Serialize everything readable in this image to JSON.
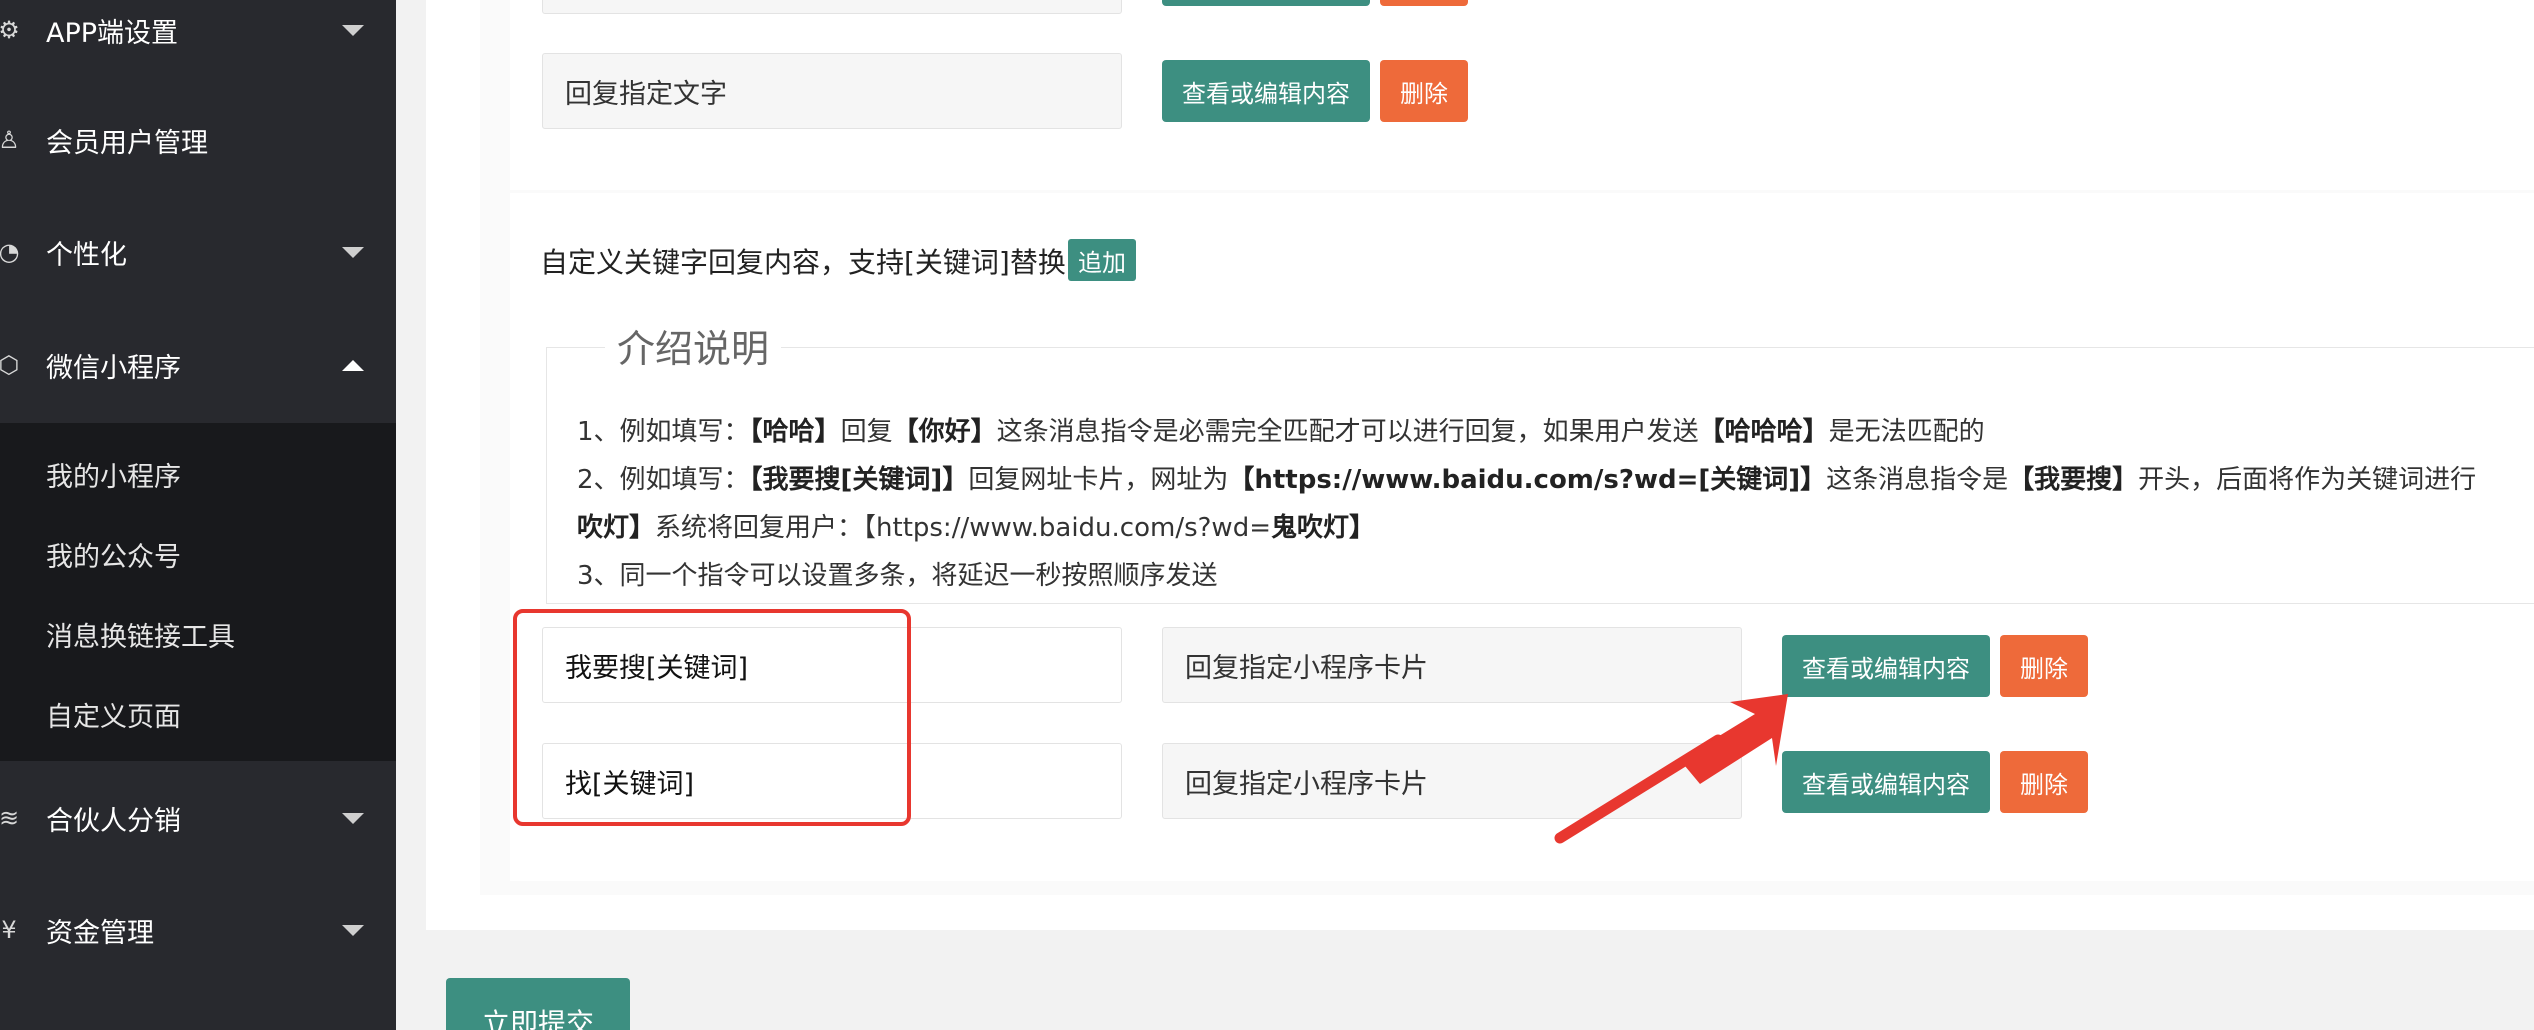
{
  "sidebar": {
    "items": [
      {
        "label": "APP端设置",
        "icon": "gear-icon",
        "glyph": "⚙",
        "state": "collapsed"
      },
      {
        "label": "会员用户管理",
        "icon": "user-icon",
        "glyph": "♙",
        "state": "none"
      },
      {
        "label": "个性化",
        "icon": "palette-icon",
        "glyph": "◔",
        "state": "collapsed"
      },
      {
        "label": "微信小程序",
        "icon": "cube-icon",
        "glyph": "⬡",
        "state": "expanded"
      },
      {
        "label": "合伙人分销",
        "icon": "layers-icon",
        "glyph": "≋",
        "state": "collapsed"
      },
      {
        "label": "资金管理",
        "icon": "yen-icon",
        "glyph": "¥",
        "state": "collapsed"
      }
    ],
    "submenu": [
      "我的小程序",
      "我的公众号",
      "消息换链接工具",
      "自定义页面"
    ]
  },
  "top": {
    "reply_text_value": "回复指定文字",
    "edit_label": "查看或编辑内容",
    "delete_label": "删除"
  },
  "keywords": {
    "title": "自定义关键字回复内容，支持[关键词]替换",
    "add_label": "追加",
    "legend": "介绍说明",
    "notes": {
      "l1_a": "1、例如填写：",
      "l1_b": "【哈哈】",
      "l1_c": "回复",
      "l1_d": "【你好】",
      "l1_e": "这条消息指令是必需完全匹配才可以进行回复，如果用户发送",
      "l1_f": "【哈哈哈】",
      "l1_g": "是无法匹配的",
      "l2_a": "2、例如填写：",
      "l2_b": "【我要搜[关键词]】",
      "l2_c": "回复网址卡片，网址为",
      "l2_d": "【https://www.baidu.com/s?wd=[关键词]】",
      "l2_e": "这条消息指令是",
      "l2_f": "【我要搜】",
      "l2_g": "开头，后面将作为关键词进行",
      "l3_a": "吹灯】",
      "l3_b": "系统将回复用户：【https://www.baidu.com/s?wd=",
      "l3_c": "鬼吹灯】",
      "l4": "3、同一个指令可以设置多条，将延迟一秒按照顺序发送"
    },
    "rows": [
      {
        "keyword": "我要搜[关键词]",
        "reply_type": "回复指定小程序卡片"
      },
      {
        "keyword": "找[关键词]",
        "reply_type": "回复指定小程序卡片"
      }
    ],
    "edit_label": "查看或编辑内容",
    "delete_label": "删除"
  },
  "submit_label": "立即提交",
  "colors": {
    "sidebar_bg": "#28292e",
    "submenu_bg": "#18191c",
    "primary": "#3d8f81",
    "danger": "#ee6a3a",
    "highlight": "#e8372f"
  }
}
